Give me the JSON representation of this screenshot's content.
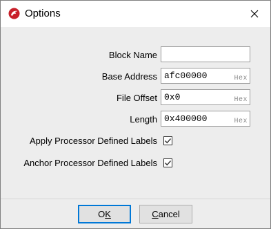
{
  "window": {
    "title": "Options"
  },
  "form": {
    "block_name": {
      "label": "Block Name",
      "value": ""
    },
    "base_address": {
      "label": "Base Address",
      "value": "afc00000",
      "hint": "Hex"
    },
    "file_offset": {
      "label": "File Offset",
      "value": "0x0",
      "hint": "Hex"
    },
    "length": {
      "label": "Length",
      "value": "0x400000",
      "hint": "Hex"
    },
    "apply_labels": {
      "label": "Apply Processor Defined Labels",
      "checked": true
    },
    "anchor_labels": {
      "label": "Anchor Processor Defined Labels",
      "checked": true
    }
  },
  "buttons": {
    "ok": {
      "pre": "O",
      "mnemonic": "K",
      "post": ""
    },
    "cancel": {
      "pre": "",
      "mnemonic": "C",
      "post": "ancel"
    }
  },
  "colors": {
    "accent": "#0078d7",
    "app_icon": "#c8202a"
  },
  "icons": {
    "app": "ghidra-dragon-icon",
    "close": "close-icon",
    "check": "checkmark-icon"
  }
}
